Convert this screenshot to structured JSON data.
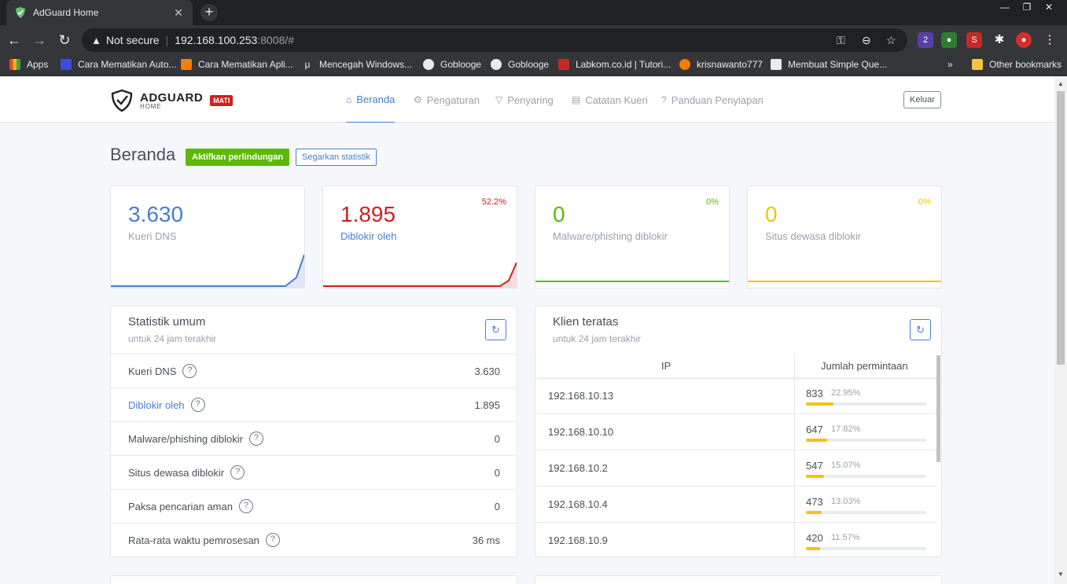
{
  "browser": {
    "tab_title": "AdGuard Home",
    "not_secure": "Not secure",
    "url_host": "192.168.100.253",
    "url_rest": ":8008/#",
    "ext_badge": "2",
    "bookmarks": [
      {
        "label": "Apps",
        "color": "#e8eaed"
      },
      {
        "label": "Cara Mematikan Auto...",
        "color": "#3b4fd8"
      },
      {
        "label": "Cara Mematikan Apli...",
        "color": "#f57d00"
      },
      {
        "label": "Mencegah Windows...",
        "color": "#35363a"
      },
      {
        "label": "Goblooge",
        "color": "#e8eaed"
      },
      {
        "label": "Goblooge",
        "color": "#e8eaed"
      },
      {
        "label": "Labkom.co.id | Tutori...",
        "color": "#c62828"
      },
      {
        "label": "krisnawanto777",
        "color": "#f57d00"
      },
      {
        "label": "Membuat Simple Que...",
        "color": "#e8eaed"
      }
    ],
    "bookmarks_more": "»",
    "other_bookmarks": "Other bookmarks"
  },
  "header": {
    "logo_main": "ADGUARD",
    "logo_sub": "HOME",
    "status_badge": "MATI",
    "nav": [
      {
        "label": "Beranda",
        "icon": "home-icon",
        "active": true
      },
      {
        "label": "Pengaturan",
        "icon": "gear-icon",
        "active": false
      },
      {
        "label": "Penyaring",
        "icon": "filter-icon",
        "active": false
      },
      {
        "label": "Catatan Kueri",
        "icon": "document-icon",
        "active": false
      },
      {
        "label": "Panduan Penyiapan",
        "icon": "help-icon",
        "active": false
      }
    ],
    "logout": "Keluar"
  },
  "page": {
    "title": "Beranda",
    "enable_protection": "Aktifkan perlindungan",
    "refresh_stats": "Segarkan statistik"
  },
  "stat_cards": [
    {
      "value": "3.630",
      "label": "Kueri DNS",
      "percent": "",
      "color": "#467fcf"
    },
    {
      "value": "1.895",
      "label": "Diblokir oleh",
      "percent": "52.2%",
      "color": "#cd201f"
    },
    {
      "value": "0",
      "label": "Malware/phishing diblokir",
      "percent": "0%",
      "color": "#5eba00"
    },
    {
      "value": "0",
      "label": "Situs dewasa diblokir",
      "percent": "0%",
      "color": "#f1c40f"
    }
  ],
  "general_stats": {
    "title": "Statistik umum",
    "subtitle": "untuk 24 jam terakhir",
    "rows": [
      {
        "label": "Kueri DNS",
        "value": "3.630",
        "link": false
      },
      {
        "label": "Diblokir oleh",
        "value": "1.895",
        "link": true
      },
      {
        "label": "Malware/phishing diblokir",
        "value": "0",
        "link": false
      },
      {
        "label": "Situs dewasa diblokir",
        "value": "0",
        "link": false
      },
      {
        "label": "Paksa pencarian aman",
        "value": "0",
        "link": false
      },
      {
        "label": "Rata-rata waktu pemrosesan",
        "value": "36 ms",
        "link": false
      }
    ]
  },
  "top_clients": {
    "title": "Klien teratas",
    "subtitle": "untuk 24 jam terakhir",
    "col_ip": "IP",
    "col_count": "Jumlah permintaan",
    "rows": [
      {
        "ip": "192.168.10.13",
        "count": "833",
        "percent": "22.95%",
        "fraction": 0.2295
      },
      {
        "ip": "192.168.10.10",
        "count": "647",
        "percent": "17.82%",
        "fraction": 0.1782
      },
      {
        "ip": "192.168.10.2",
        "count": "547",
        "percent": "15.07%",
        "fraction": 0.1507
      },
      {
        "ip": "192.168.10.4",
        "count": "473",
        "percent": "13.03%",
        "fraction": 0.1303
      },
      {
        "ip": "192.168.10.9",
        "count": "420",
        "percent": "11.57%",
        "fraction": 0.1157
      }
    ]
  }
}
